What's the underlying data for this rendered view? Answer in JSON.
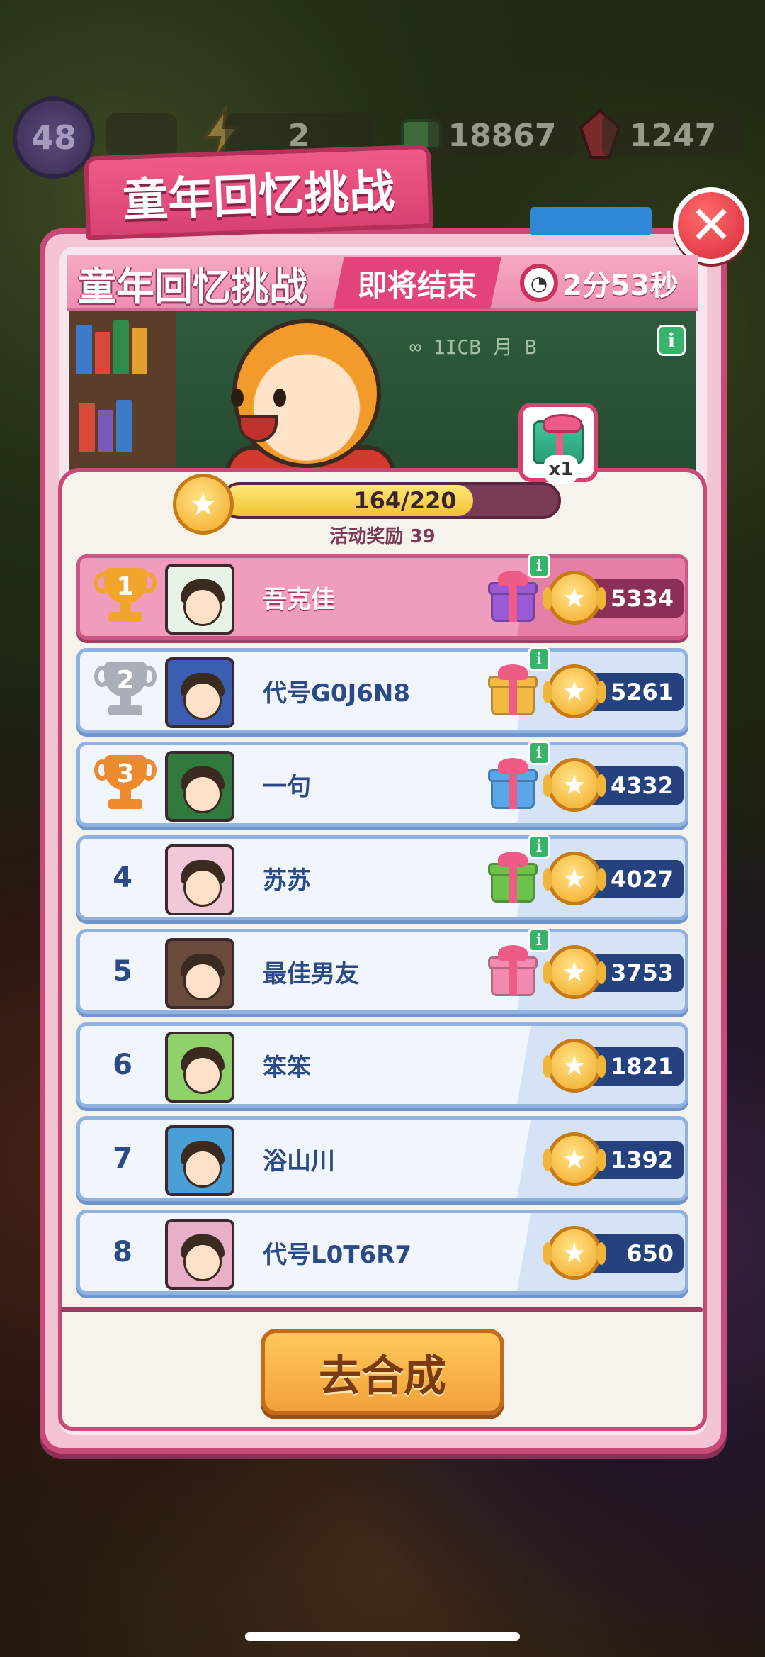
{
  "resources": {
    "level": "48",
    "energy": "2",
    "coins": "18867",
    "gems": "1247"
  },
  "dialog": {
    "banner_title": "童年回忆挑战",
    "event_title": "童年回忆挑战",
    "status_tag": "即将结束",
    "timer": "2分53秒",
    "info_symbol": "i",
    "reward_multiplier": "x1",
    "progress_text": "164/220",
    "progress_fraction": 0.745,
    "reward_caption": "活动奖励 39",
    "close_symbol": "✕",
    "action_button": "去合成"
  },
  "chalkboard_text": "∞ 1ICB  月  B",
  "leaderboard": [
    {
      "rank": "1",
      "name": "吾克佳",
      "score": "5334",
      "gift_color": "#9b59d6",
      "has_gift": true,
      "avatar_color": "#e8f3e8"
    },
    {
      "rank": "2",
      "name": "代号G0J6N8",
      "score": "5261",
      "gift_color": "#f4b942",
      "has_gift": true,
      "avatar_color": "#3a5fb0"
    },
    {
      "rank": "3",
      "name": "一句",
      "score": "4332",
      "gift_color": "#5aa6e8",
      "has_gift": true,
      "avatar_color": "#2f7a3c"
    },
    {
      "rank": "4",
      "name": "苏苏",
      "score": "4027",
      "gift_color": "#6cc24a",
      "has_gift": true,
      "avatar_color": "#f2c8d8"
    },
    {
      "rank": "5",
      "name": "最佳男友",
      "score": "3753",
      "gift_color": "#f28bb0",
      "has_gift": true,
      "avatar_color": "#6a4a3a"
    },
    {
      "rank": "6",
      "name": "笨笨",
      "score": "1821",
      "has_gift": false,
      "avatar_color": "#8fd16a"
    },
    {
      "rank": "7",
      "name": "浴山川",
      "score": "1392",
      "has_gift": false,
      "avatar_color": "#4a9fd6"
    },
    {
      "rank": "8",
      "name": "代号L0T6R7",
      "score": "650",
      "has_gift": false,
      "avatar_color": "#e8b0c8"
    }
  ],
  "colors": {
    "accent_pink": "#d94270",
    "row_blue": "#25427e",
    "button_orange": "#f2a23a"
  }
}
